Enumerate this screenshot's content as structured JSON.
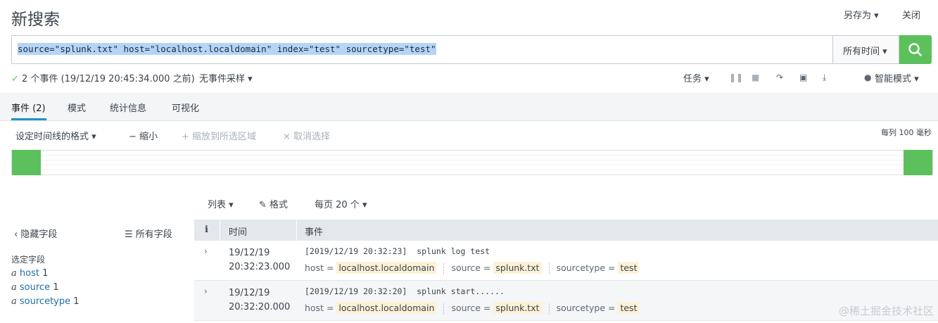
{
  "header": {
    "title": "新搜索",
    "save_as": "另存为 ▾",
    "close": "关闭"
  },
  "search": {
    "query": "source=\"splunk.txt\" host=\"localhost.localdomain\" index=\"test\" sourcetype=\"test\"",
    "time_range": "所有时间 ▾"
  },
  "status": {
    "check": "✓",
    "summary": "2 个事件 (19/12/19 20:45:34.000 之前)",
    "sampling": "无事件采样 ▾",
    "job": "任务 ▾",
    "mode": "智能模式 ▾"
  },
  "tabs": [
    "事件 (2)",
    "模式",
    "统计信息",
    "可视化"
  ],
  "timeline": {
    "format": "设定时间线的格式 ▾",
    "zoom_out": "− 缩小",
    "zoom_sel": "+ 缩放到所选区域",
    "deselect": "× 取消选择",
    "scale": "每列 100 毫秒"
  },
  "results_toolbar": {
    "list": "列表 ▾",
    "format": "格式",
    "per_page": "每页 20 个 ▾"
  },
  "sidebar": {
    "hide_fields": "隐藏字段",
    "all_fields": "所有字段",
    "selected_title": "选定字段",
    "fields": [
      {
        "icon": "a",
        "name": "host",
        "count": "1"
      },
      {
        "icon": "a",
        "name": "source",
        "count": "1"
      },
      {
        "icon": "a",
        "name": "sourcetype",
        "count": "1"
      }
    ]
  },
  "table": {
    "col_info": "i",
    "col_time": "时间",
    "col_event": "事件",
    "rows": [
      {
        "date": "19/12/19",
        "time": "20:32:23.000",
        "raw": "[2019/12/19 20:32:23]  splunk log test",
        "host_k": "host =",
        "host_v": "localhost.localdomain",
        "source_k": "source =",
        "source_v": "splunk.txt",
        "st_k": "sourcetype =",
        "st_v": "test"
      },
      {
        "date": "19/12/19",
        "time": "20:32:20.000",
        "raw": "[2019/12/19 20:32:20]  splunk start......",
        "host_k": "host =",
        "host_v": "localhost.localdomain",
        "source_k": "source =",
        "source_v": "splunk.txt",
        "st_k": "sourcetype =",
        "st_v": "test"
      }
    ]
  },
  "watermark": "@稀土掘金技术社区"
}
